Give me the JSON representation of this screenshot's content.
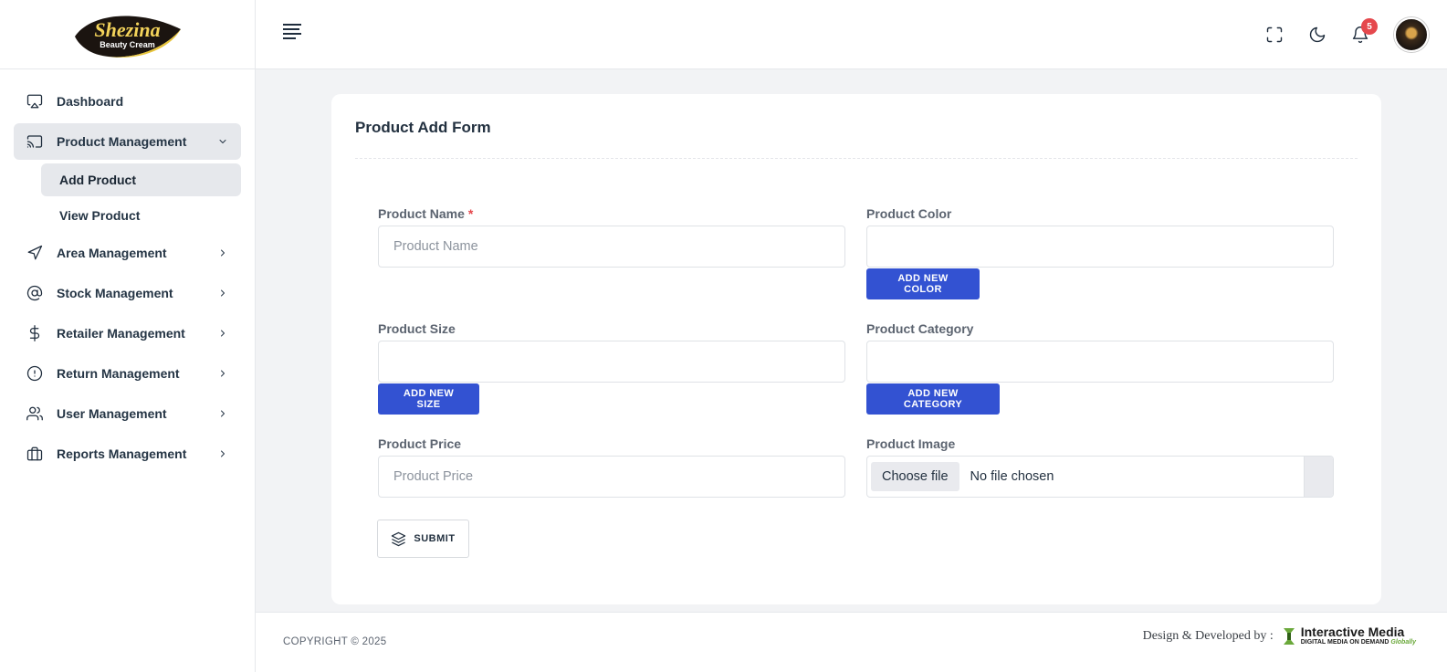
{
  "brand": {
    "name": "Shezina",
    "subtitle": "Beauty Cream"
  },
  "sidebar": {
    "items": [
      {
        "label": "Dashboard",
        "icon": "monitor-icon"
      },
      {
        "label": "Product Management",
        "icon": "cast-icon",
        "expanded": true,
        "children": [
          {
            "label": "Add Product",
            "active": true
          },
          {
            "label": "View Product"
          }
        ]
      },
      {
        "label": "Area Management",
        "icon": "send-icon"
      },
      {
        "label": "Stock Management",
        "icon": "at-sign-icon"
      },
      {
        "label": "Retailer Management",
        "icon": "dollar-icon"
      },
      {
        "label": "Return Management",
        "icon": "alert-circle-icon"
      },
      {
        "label": "User Management",
        "icon": "users-icon"
      },
      {
        "label": "Reports Management",
        "icon": "briefcase-icon"
      }
    ]
  },
  "topbar": {
    "notification_count": "5"
  },
  "form": {
    "title": "Product Add Form",
    "product_name": {
      "label": "Product Name",
      "required_mark": "*",
      "placeholder": "Product Name"
    },
    "product_color": {
      "label": "Product Color",
      "button": "ADD NEW COLOR"
    },
    "product_size": {
      "label": "Product Size",
      "button": "ADD NEW SIZE"
    },
    "product_category": {
      "label": "Product Category",
      "button": "ADD NEW CATEGORY"
    },
    "product_price": {
      "label": "Product Price",
      "placeholder": "Product Price"
    },
    "product_image": {
      "label": "Product Image",
      "choose_label": "Choose file",
      "status": "No file chosen"
    },
    "submit": "SUBMIT"
  },
  "footer": {
    "copyright": "COPYRIGHT © 2025",
    "credit": "Design & Developed by :",
    "company": "Interactive Media",
    "tagline": "DIGITAL MEDIA ON DEMAND",
    "tagline_accent": "Globally"
  },
  "colors": {
    "primary": "#3352d2",
    "badge": "#e5484d",
    "active_bg": "#e6e8ec"
  }
}
